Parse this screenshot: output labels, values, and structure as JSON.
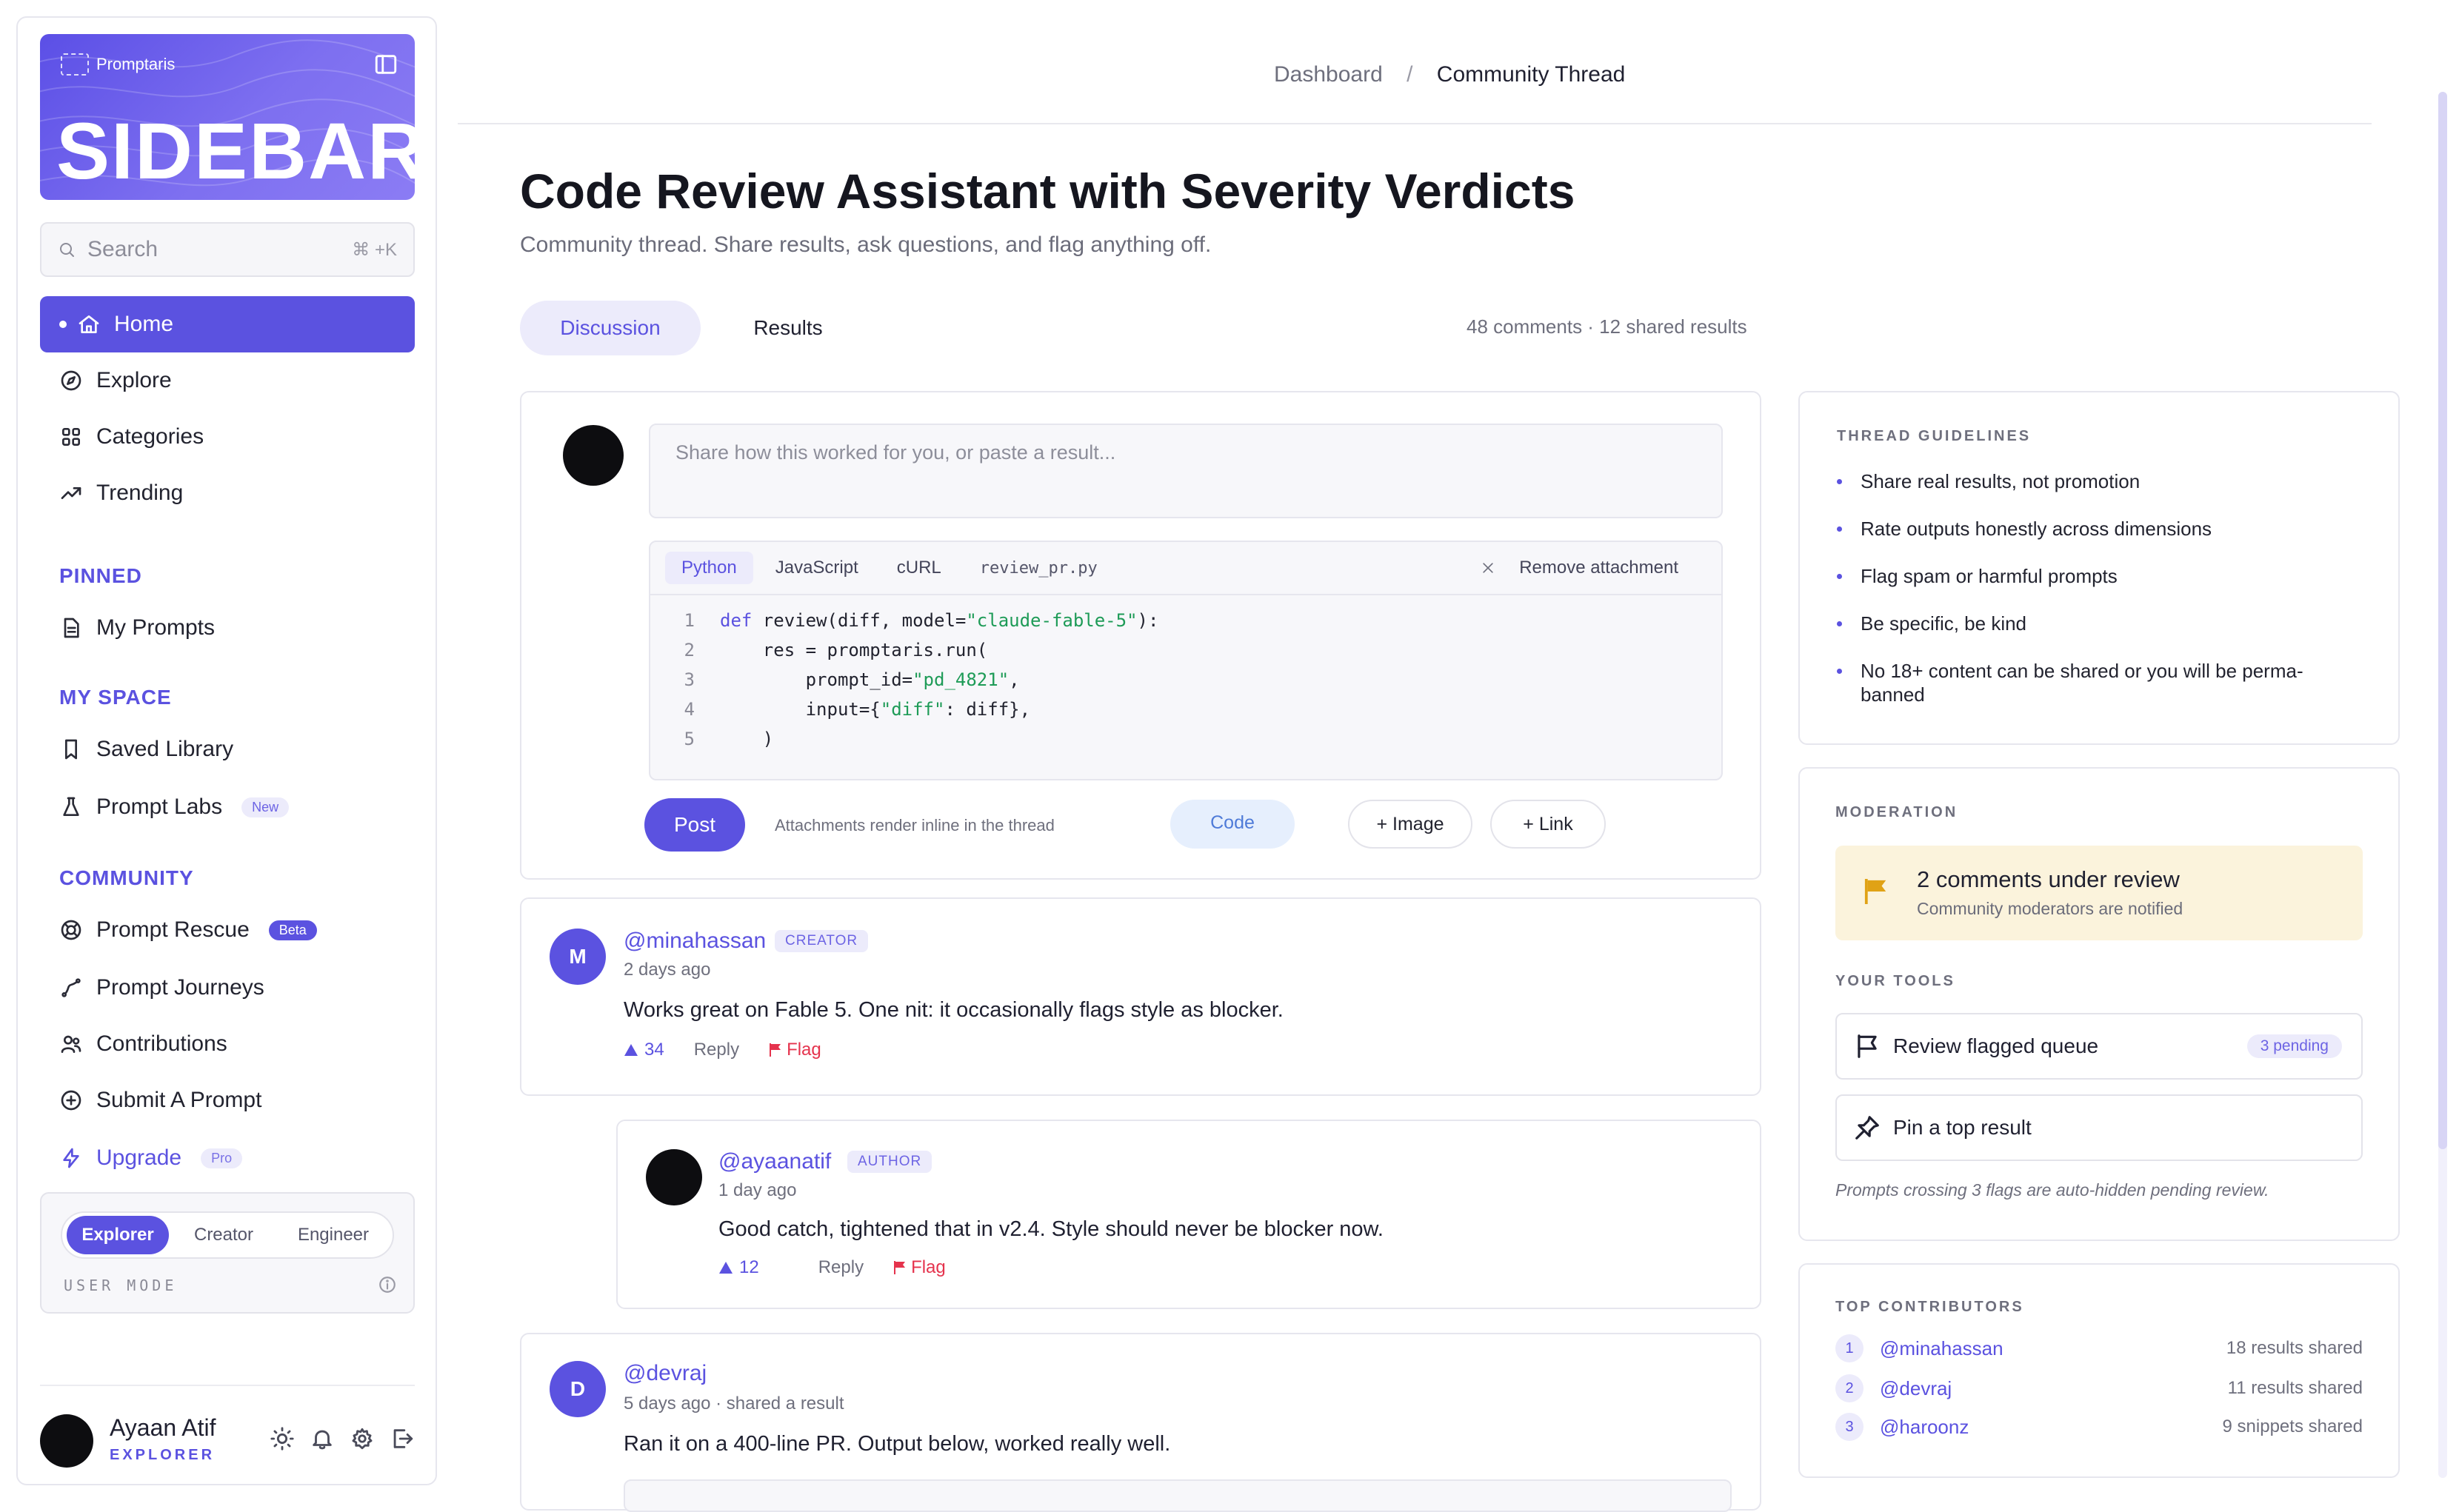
{
  "sidebar": {
    "brand": "Promptaris",
    "banner_title": "SIDEBAR",
    "search": {
      "placeholder": "Search",
      "shortcut": "⌘ +K"
    },
    "nav": [
      {
        "label": "Home",
        "icon": "home-icon",
        "active": true
      },
      {
        "label": "Explore",
        "icon": "compass-icon"
      },
      {
        "label": "Categories",
        "icon": "grid-icon"
      },
      {
        "label": "Trending",
        "icon": "trending-icon"
      }
    ],
    "pinned_label": "PINNED",
    "pinned": [
      {
        "label": "My Prompts",
        "icon": "file-icon"
      }
    ],
    "myspace_label": "MY SPACE",
    "myspace": [
      {
        "label": "Saved Library",
        "icon": "bookmark-icon"
      },
      {
        "label": "Prompt Labs",
        "icon": "flask-icon",
        "badge": "New"
      }
    ],
    "community_label": "COMMUNITY",
    "community": [
      {
        "label": "Prompt Rescue",
        "icon": "lifebuoy-icon",
        "badge": "Beta"
      },
      {
        "label": "Prompt Journeys",
        "icon": "path-icon"
      },
      {
        "label": "Contributions",
        "icon": "users-icon"
      },
      {
        "label": "Submit A Prompt",
        "icon": "plus-circle-icon"
      },
      {
        "label": "Upgrade",
        "icon": "bolt-icon",
        "badge": "Pro"
      }
    ],
    "user_mode": {
      "options": [
        "Explorer",
        "Creator",
        "Engineer"
      ],
      "selected": "Explorer",
      "label": "USER MODE"
    },
    "user": {
      "name": "Ayaan Atif",
      "role": "EXPLORER"
    }
  },
  "breadcrumb": {
    "parent": "Dashboard",
    "separator": "/",
    "current": "Community Thread"
  },
  "page": {
    "title": "Code Review Assistant with Severity Verdicts",
    "subtitle": "Community thread. Share results, ask questions, and flag anything off.",
    "tabs": [
      {
        "label": "Discussion",
        "active": true
      },
      {
        "label": "Results",
        "active": false
      }
    ],
    "counts": "48 comments · 12 shared results"
  },
  "composer": {
    "placeholder": "Share how this worked for you, or paste a result...",
    "code_tabs": [
      "Python",
      "JavaScript",
      "cURL"
    ],
    "selected_tab": "Python",
    "file_name": "review_pr.py",
    "remove_label": "Remove attachment",
    "code_line_numbers": [
      "1",
      "2",
      "3",
      "4",
      "5"
    ],
    "post_label": "Post",
    "hint": "Attachments render inline in the thread",
    "chips": [
      "Code",
      "+ Image",
      "+ Link"
    ]
  },
  "comments": [
    {
      "initial": "M",
      "handle": "@minahassan",
      "badge": "CREATOR",
      "time": "2 days ago",
      "text": "Works great on Fable 5. One nit: it occasionally flags style as blocker.",
      "votes": "34",
      "reply": "Reply",
      "flag": "Flag"
    },
    {
      "initial": "",
      "handle": "@ayaanatif",
      "badge": "AUTHOR",
      "time": "1 day ago",
      "text": "Good catch, tightened that in v2.4. Style should never be blocker now.",
      "votes": "12",
      "reply": "Reply",
      "flag": "Flag"
    },
    {
      "initial": "D",
      "handle": "@devraj",
      "badge": "",
      "time": "5 days ago · shared a result",
      "text": "Ran it on a 400-line PR. Output below, worked really well."
    }
  ],
  "guidelines": {
    "label": "THREAD GUIDELINES",
    "items": [
      "Share real results, not promotion",
      "Rate outputs honestly across dimensions",
      "Flag spam or harmful prompts",
      "Be specific, be kind",
      "No 18+ content can be shared or you will be perma-banned"
    ]
  },
  "moderation": {
    "label": "MODERATION",
    "review_title": "2 comments under review",
    "review_sub": "Community moderators are notified",
    "tools_label": "YOUR TOOLS",
    "tool1": "Review flagged queue",
    "tool1_badge": "3 pending",
    "tool2": "Pin a top result",
    "note": "Prompts crossing 3 flags are auto-hidden pending review."
  },
  "contributors": {
    "label": "TOP CONTRIBUTORS",
    "items": [
      {
        "rank": "1",
        "name": "@minahassan",
        "count": "18 results shared"
      },
      {
        "rank": "2",
        "name": "@devraj",
        "count": "11 results shared"
      },
      {
        "rank": "3",
        "name": "@haroonz",
        "count": "9 snippets shared"
      }
    ]
  },
  "colors": {
    "accent": "#5b52e0",
    "flag": "#e5334d",
    "review_bg": "#fbf3dc",
    "string": "#1e9b57"
  }
}
